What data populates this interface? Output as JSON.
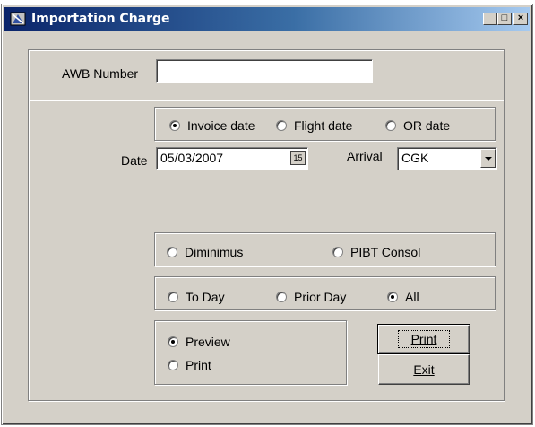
{
  "window": {
    "title": "Importation Charge",
    "controls": {
      "minimize": "_",
      "maximize": "□",
      "close": "×"
    }
  },
  "awb": {
    "label": "AWB Number",
    "value": ""
  },
  "date_type": {
    "options": [
      "Invoice date",
      "Flight date",
      "OR date"
    ],
    "selected": "Invoice date"
  },
  "date": {
    "label": "Date",
    "value": "05/03/2007",
    "calendar_icon_text": "15"
  },
  "arrival": {
    "label": "Arrival",
    "value": "CGK"
  },
  "category": {
    "options": [
      "Diminimus",
      "PIBT Consol"
    ],
    "selected": null
  },
  "period": {
    "options": [
      "To Day",
      "Prior Day",
      "All"
    ],
    "selected": "All"
  },
  "output": {
    "options": [
      "Preview",
      "Print"
    ],
    "selected": "Preview"
  },
  "buttons": {
    "print": "Print",
    "exit": "Exit"
  }
}
